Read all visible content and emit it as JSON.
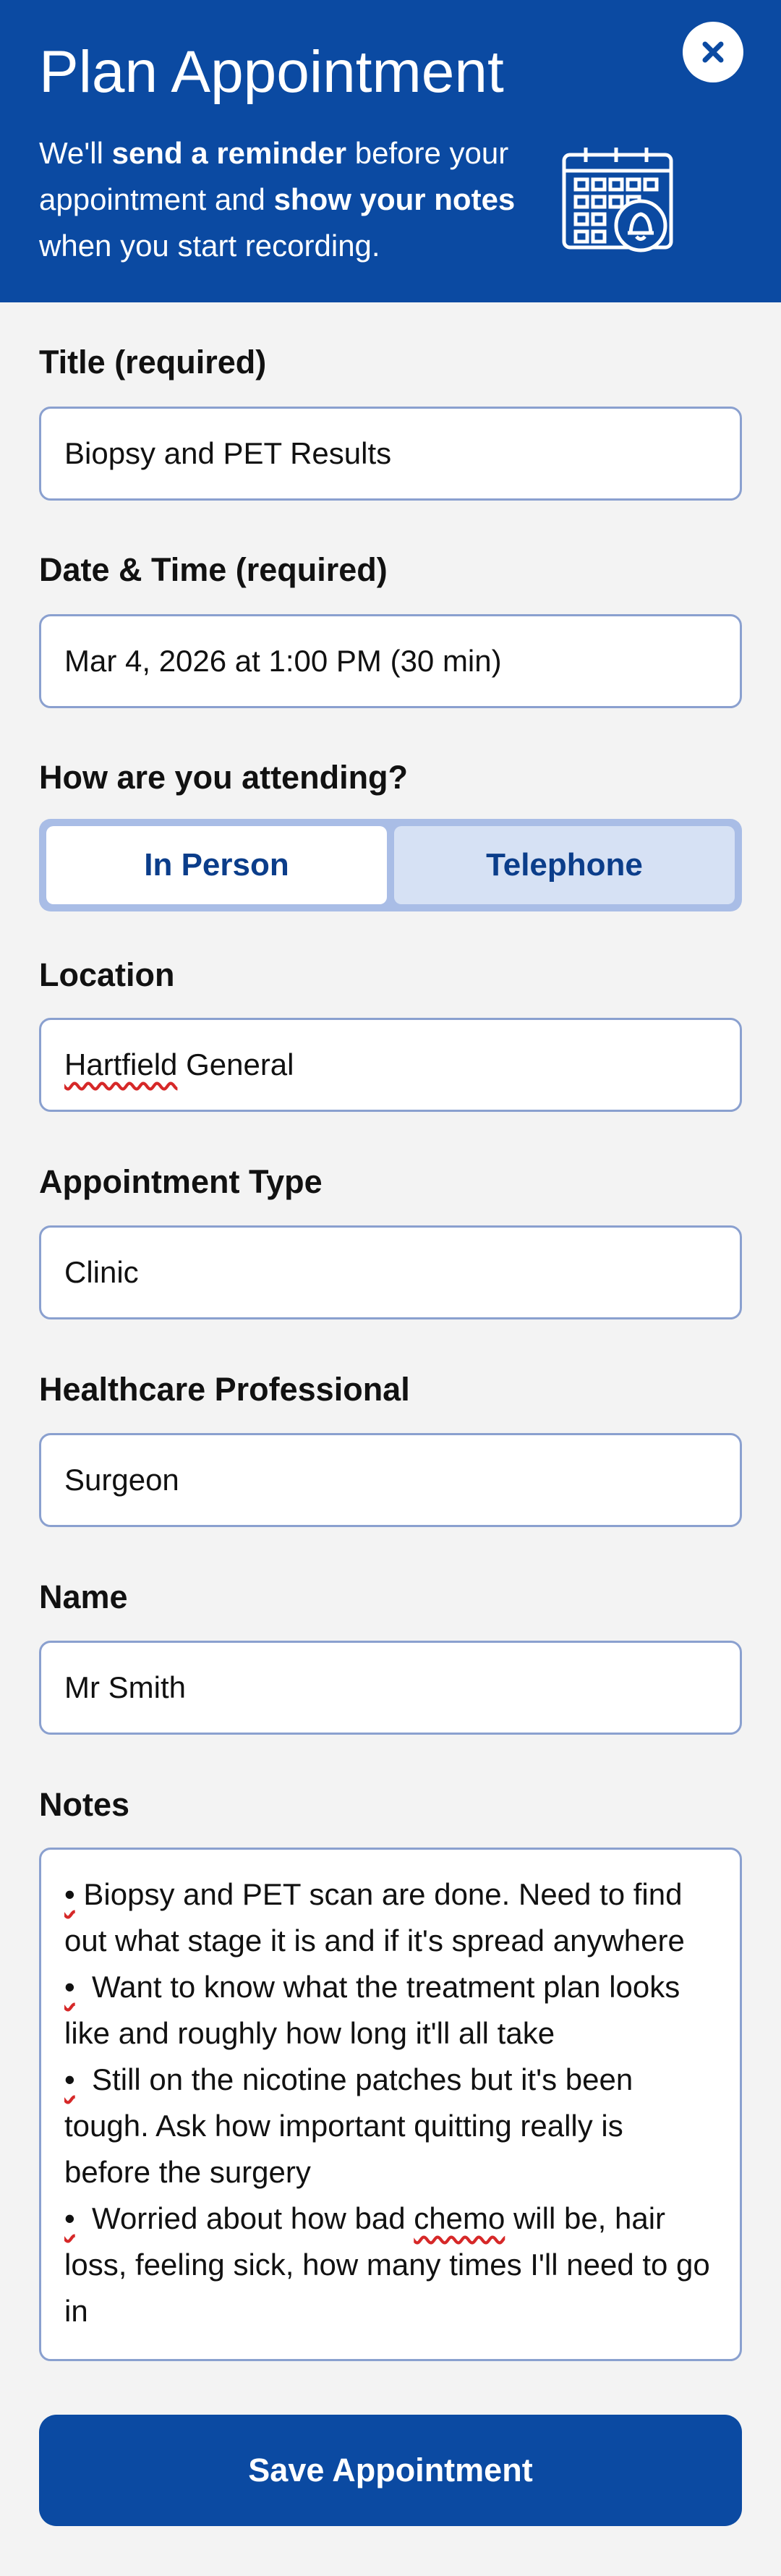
{
  "header": {
    "title": "Plan Appointment",
    "subtitle": {
      "p1": "We'll ",
      "b1": "send a reminder",
      "p2": " before your appointment and ",
      "b2": "show your notes",
      "p3": " when you start recording."
    },
    "close_icon": "close-icon",
    "calendar_icon": "calendar-bell-icon",
    "background_color": "#0b4aa2"
  },
  "form": {
    "title": {
      "label": "Title (required)",
      "value": "Biopsy and PET Results"
    },
    "datetime": {
      "label": "Date & Time (required)",
      "value": "Mar 4, 2026 at 1:00 PM (30 min)"
    },
    "attendance": {
      "label": "How are you attending?",
      "options": [
        "In Person",
        "Telephone"
      ],
      "selected": "In Person"
    },
    "location": {
      "label": "Location",
      "value_word1": "Hartfield",
      "value_word2": " General"
    },
    "appointment_type": {
      "label": "Appointment Type",
      "value": "Clinic"
    },
    "professional": {
      "label": "Healthcare Professional",
      "value": "Surgeon"
    },
    "name": {
      "label": "Name",
      "value": "Mr Smith"
    },
    "notes": {
      "label": "Notes",
      "bullet": "•",
      "items": [
        " Biopsy and PET scan are done. Need to find out what stage it is and if it's spread anywhere",
        "  Want to know what the treatment plan looks like and roughly how long it'll all take",
        "  Still on the nicotine patches but it's been tough. Ask how important quitting really is before the surgery"
      ],
      "item4_a": "  Worried about how bad ",
      "item4_spell": "chemo",
      "item4_b": " will be, hair loss, feeling sick, how many times I'll need to go in"
    }
  },
  "save_button": {
    "label": "Save Appointment"
  }
}
